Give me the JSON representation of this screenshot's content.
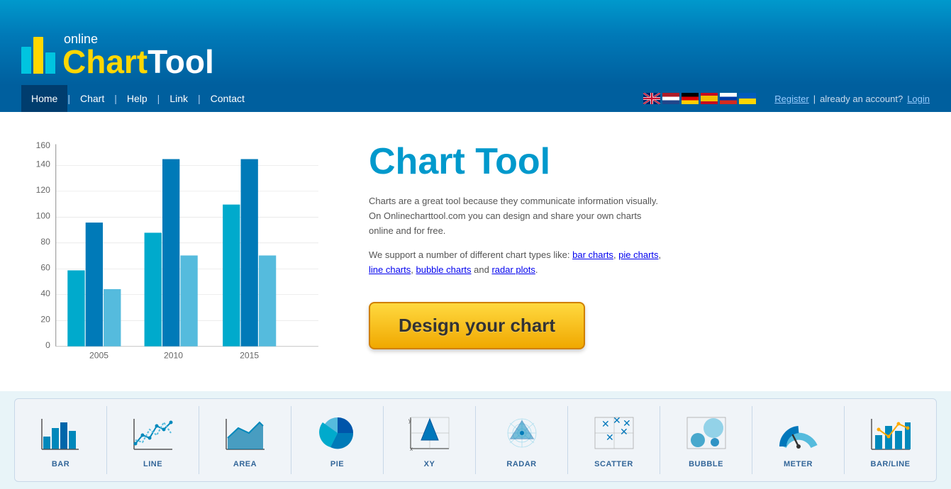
{
  "header": {
    "logo_online": "online",
    "logo_chart": "Chart",
    "logo_tool": "Tool"
  },
  "nav": {
    "items": [
      {
        "label": "Home",
        "active": true
      },
      {
        "label": "Chart",
        "active": false
      },
      {
        "label": "Help",
        "active": false
      },
      {
        "label": "Link",
        "active": false
      },
      {
        "label": "Contact",
        "active": false
      }
    ],
    "auth": {
      "register": "Register",
      "separator": "|",
      "already": "already an account?",
      "login": "Login"
    }
  },
  "main": {
    "title": "Chart Tool",
    "description1": "Charts are a great tool because they communicate information visually. On Onlinecharttool.com you can design and share your own charts online and for free.",
    "description2": "We support a number of different chart types like:",
    "links": {
      "bar": "bar charts",
      "pie": "pie charts",
      "line": "line charts",
      "bubble": "bubble charts",
      "radar": "radar plots"
    },
    "cta_button": "Design your chart"
  },
  "chart": {
    "y_labels": [
      "0",
      "20",
      "40",
      "60",
      "80",
      "100",
      "120",
      "140",
      "160"
    ],
    "x_labels": [
      "2005",
      "2010",
      "2015"
    ],
    "bars": [
      {
        "group": "2005",
        "v1": 60,
        "v2": 98,
        "v3": 45
      },
      {
        "group": "2010",
        "v1": 90,
        "v2": 148,
        "v3": 72
      },
      {
        "group": "2015",
        "v1": 112,
        "v2": 148,
        "v3": 72
      }
    ]
  },
  "chart_types": [
    {
      "label": "BAR",
      "type": "bar"
    },
    {
      "label": "LINE",
      "type": "line"
    },
    {
      "label": "AREA",
      "type": "area"
    },
    {
      "label": "PIE",
      "type": "pie"
    },
    {
      "label": "XY",
      "type": "xy"
    },
    {
      "label": "RADAR",
      "type": "radar"
    },
    {
      "label": "SCATTER",
      "type": "scatter"
    },
    {
      "label": "BUBBLE",
      "type": "bubble"
    },
    {
      "label": "METER",
      "type": "meter"
    },
    {
      "label": "BAR/LINE",
      "type": "bar-line"
    }
  ]
}
